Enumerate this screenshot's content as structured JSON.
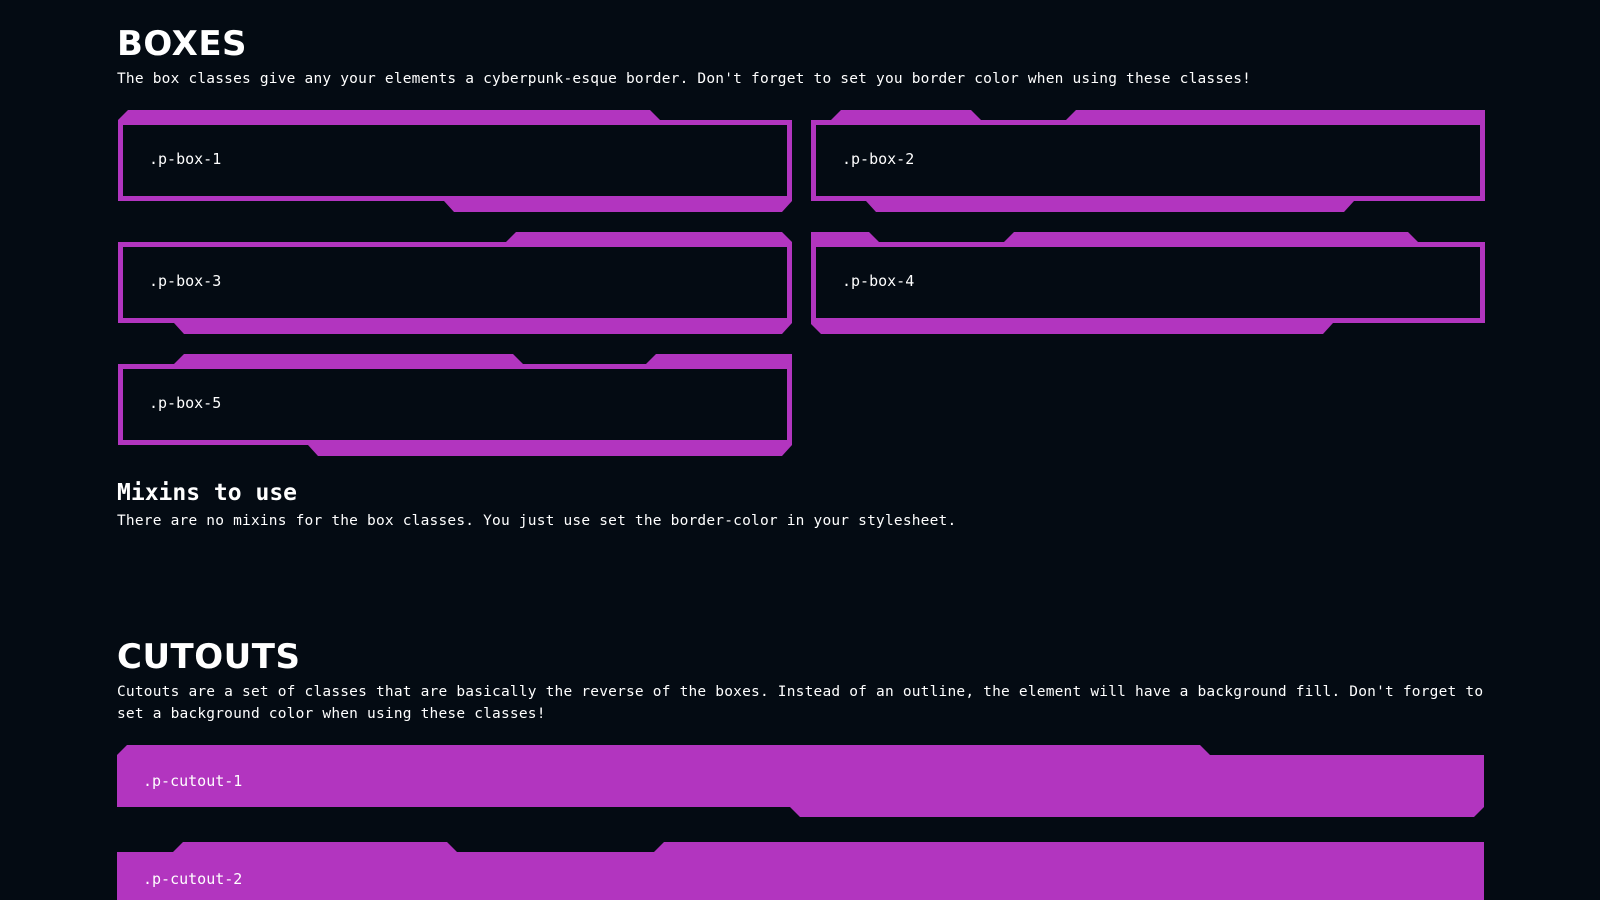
{
  "boxes": {
    "title": "BOXES",
    "description": "The box classes give any your elements a cyberpunk-esque border. Don't forget to set you border color when using these classes!",
    "items": [
      ".p-box-1",
      ".p-box-2",
      ".p-box-3",
      ".p-box-4",
      ".p-box-5"
    ],
    "border_color": "#b235bf"
  },
  "mixins": {
    "title": "Mixins to use",
    "description": "There are no mixins for the box classes. You just use set the border-color in your stylesheet."
  },
  "cutouts": {
    "title": "CUTOUTS",
    "description": "Cutouts are a set of classes that are basically the reverse of the boxes. Instead of an outline, the element will have a background fill. Don't forget to set a background color when using these classes!",
    "items": [
      ".p-cutout-1",
      ".p-cutout-2"
    ],
    "fill_color": "#b235bf"
  },
  "theme": {
    "background": "#040b13",
    "text": "#ffffff",
    "accent": "#b235bf"
  }
}
